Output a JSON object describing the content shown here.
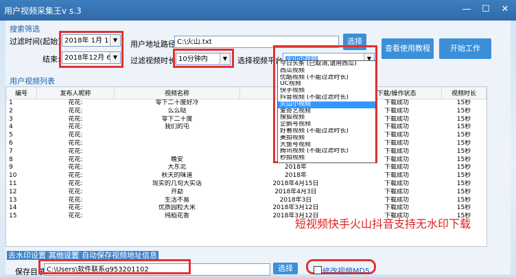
{
  "window": {
    "title": "用户视频采集王v s.3"
  },
  "search": {
    "group_label": "搜索筛选",
    "date_start_label": "过滤时间(起始):",
    "date_start": "2018年 1月 1日",
    "date_end_label": "结束:",
    "date_end": "2018年12月 6日",
    "url_label": "用户地址路径:",
    "url_value": "C:\\火山.txt",
    "choose_label": "选择",
    "duration_label": "过滤视频时长:",
    "duration_value": "10分钟内",
    "platform_label": "选择视频平台",
    "platform_value": "火山小视频",
    "tutorial_label": "查看使用教程",
    "start_label": "开始工作"
  },
  "platform_options": [
    {
      "label": "今日头条 (已取消,请用西瓜)",
      "selected": false
    },
    {
      "label": "西瓜视频",
      "selected": false
    },
    {
      "label": "优酷视频 (不能过滤时长)",
      "selected": false
    },
    {
      "label": "UC视频",
      "selected": false
    },
    {
      "label": "快手视频",
      "selected": false
    },
    {
      "label": "抖音视频 (不能过滤时长)",
      "selected": false
    },
    {
      "label": "火山小视频",
      "selected": true
    },
    {
      "label": "爱奇艺视频",
      "selected": false
    },
    {
      "label": "搜狐视频",
      "selected": false
    },
    {
      "label": "企鹅号视频",
      "selected": false
    },
    {
      "label": "好看视频 (不能过滤时长)",
      "selected": false
    },
    {
      "label": "美拍视频",
      "selected": false
    },
    {
      "label": "大鱼号视频",
      "selected": false
    },
    {
      "label": "腾讯视频 (不能过滤时长)",
      "selected": false
    },
    {
      "label": "秒拍视频",
      "selected": false
    }
  ],
  "list": {
    "group_label": "用户视频列表",
    "columns": [
      "编号",
      "发布人昵称",
      "视频名称",
      "发布时间",
      "下载/操作状态",
      "视频时长"
    ],
    "rows": [
      [
        "1",
        "花花:",
        "零下二十度好冷",
        "2018年",
        "下载成功",
        "15秒"
      ],
      [
        "2",
        "花花:",
        "么么哒",
        "2018年",
        "下载成功",
        "15秒"
      ],
      [
        "3",
        "花花:",
        "零下二十度",
        "2018年",
        "下载成功",
        "15秒"
      ],
      [
        "4",
        "花花:",
        "我们的屯",
        "2018年",
        "下载成功",
        "15秒"
      ],
      [
        "5",
        "花花:",
        "",
        "2018年",
        "下载成功",
        "15秒"
      ],
      [
        "6",
        "花花:",
        "",
        "2018年",
        "下载成功",
        "15秒"
      ],
      [
        "7",
        "花花:",
        "",
        "2018年",
        "下载成功",
        "15秒"
      ],
      [
        "8",
        "花花:",
        "晚安",
        "2018年",
        "下载成功",
        "15秒"
      ],
      [
        "9",
        "花花:",
        "大东北",
        "2018年",
        "下载成功",
        "15秒"
      ],
      [
        "10",
        "花花:",
        "秋天的味道",
        "2018年",
        "下载成功",
        "15秒"
      ],
      [
        "11",
        "花花:",
        "现实的几句大实话",
        "2018年4月15日",
        "下载成功",
        "15秒"
      ],
      [
        "12",
        "花花:",
        "开勐",
        "2018年4月3日",
        "下载成功",
        "15秒"
      ],
      [
        "13",
        "花花:",
        "生活不易",
        "2018年3日",
        "下载成功",
        "15秒"
      ],
      [
        "14",
        "花花:",
        "优质园粒大米",
        "2018年3月12日",
        "下载成功",
        "15秒"
      ],
      [
        "15",
        "花花:",
        "纯稻花香",
        "2018年3月12日",
        "下载成功",
        "15秒"
      ]
    ]
  },
  "overlay_caption": "短视频快手火山抖音支持无水印下载",
  "bottom": {
    "tab1": "去水印设置",
    "tab2": "其他设置",
    "tab3": "自动保存视频地址信息",
    "save_dir_label": "保存目录:",
    "save_dir_value": "C:\\Users\\软件联系q953201102",
    "choose_label": "选择",
    "md5_label": "修改视频MD5"
  }
}
